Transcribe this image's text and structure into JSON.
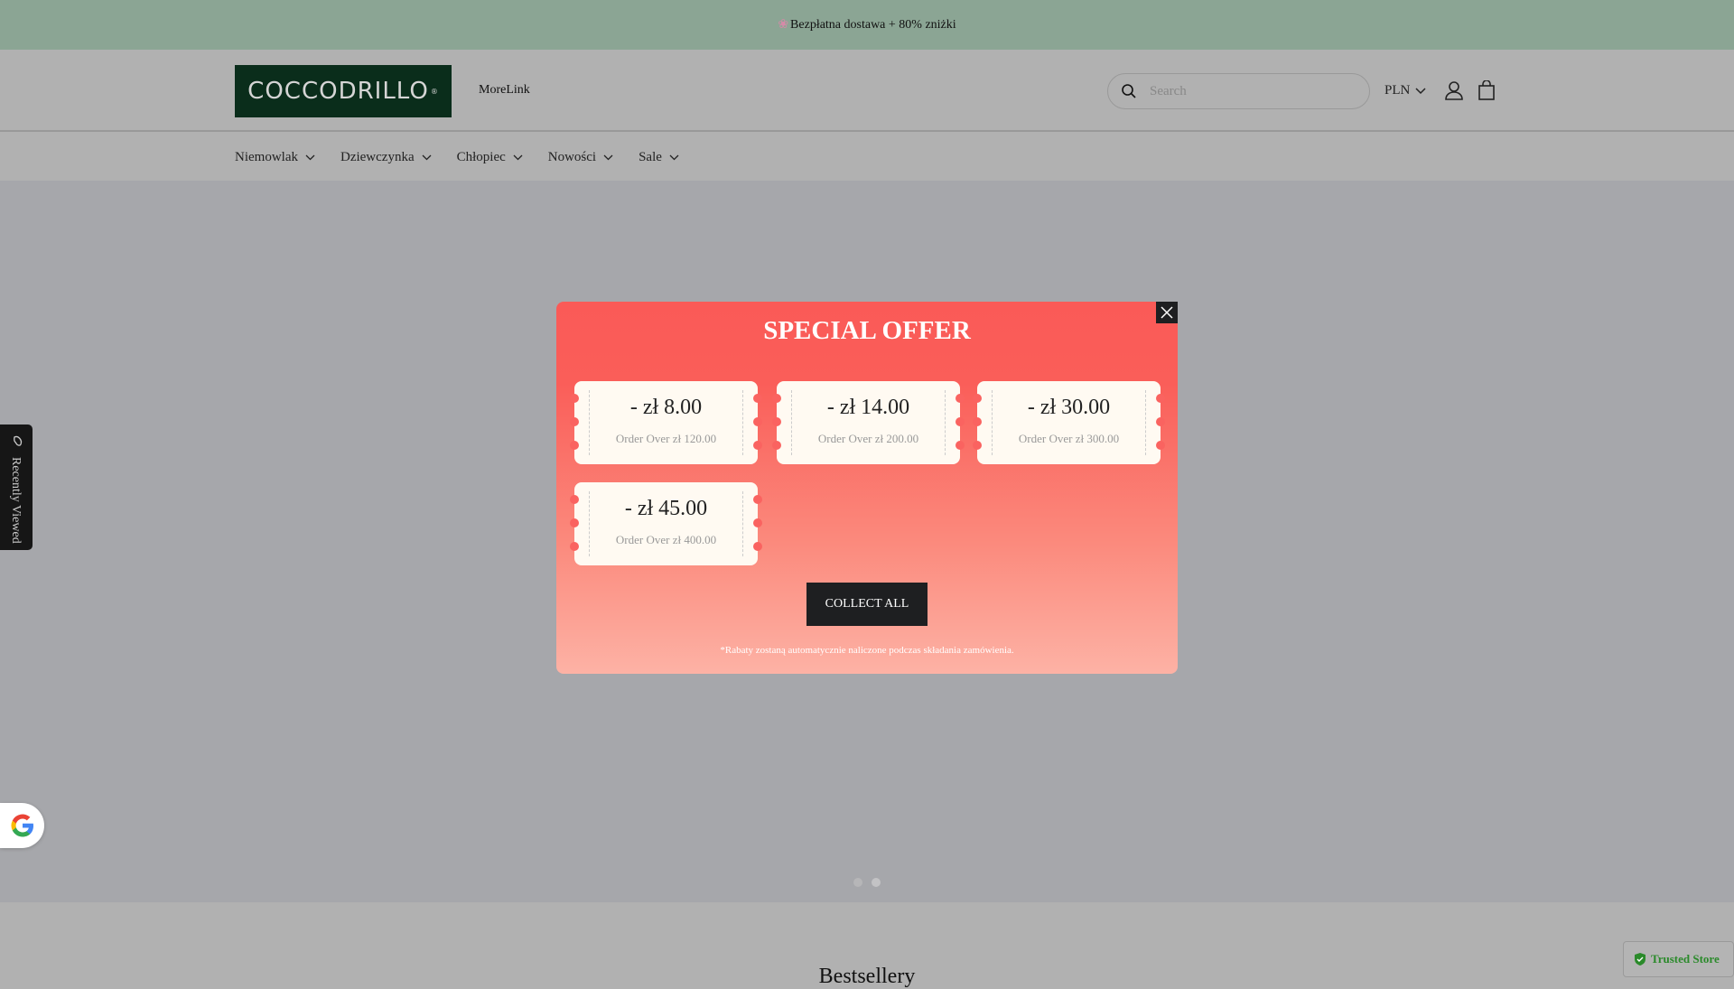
{
  "banner": {
    "text": "Bezpłatna dostawa + 80% zniżki",
    "icon": "flower-icon"
  },
  "header": {
    "logo": "COCCODRILLO",
    "logo_mark": "®",
    "more_link": "MoreLink",
    "search_placeholder": "Search",
    "currency": "PLN"
  },
  "nav": {
    "items": [
      {
        "label": "Niemowlak"
      },
      {
        "label": "Dziewczynka"
      },
      {
        "label": "Chłopiec"
      },
      {
        "label": "Nowości"
      },
      {
        "label": "Sale"
      }
    ]
  },
  "carousel": {
    "slides": 2,
    "active": 2
  },
  "popup": {
    "title": "SPECIAL OFFER",
    "coupons": [
      {
        "amount": "- zł 8.00",
        "condition": "Order Over zł 120.00"
      },
      {
        "amount": "- zł 14.00",
        "condition": "Order Over zł 200.00"
      },
      {
        "amount": "- zł 30.00",
        "condition": "Order Over zł 300.00"
      },
      {
        "amount": "- zł 45.00",
        "condition": "Order Over zł 400.00"
      }
    ],
    "collect_label": "COLLECT ALL",
    "note": "*Rabaty zostaną automatycznie naliczone podczas składania zamówienia.",
    "colors": {
      "top": "#fa5a57",
      "bottom": "#fdb2a5"
    }
  },
  "recently_viewed": "Recently Viewed",
  "section_title": "Bestsellery",
  "trusted_store": "Trusted Store"
}
